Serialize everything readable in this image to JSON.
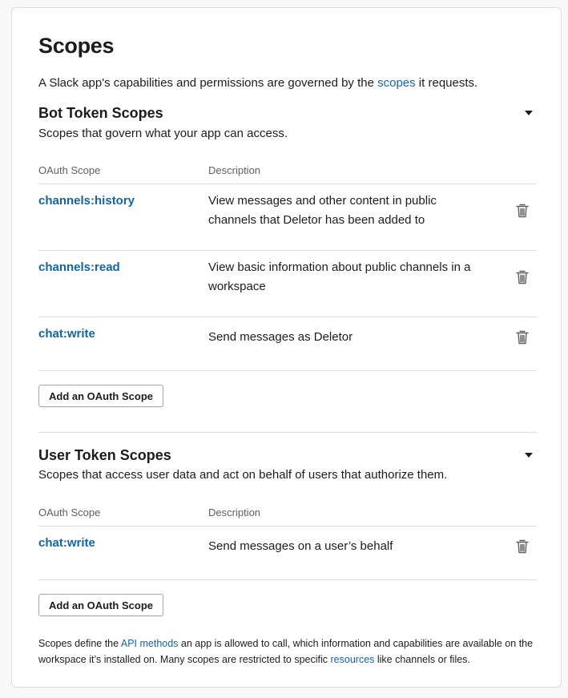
{
  "title": "Scopes",
  "intro": {
    "before": "A Slack app's capabilities and permissions are governed by the ",
    "link": "scopes",
    "after": " it requests."
  },
  "bot": {
    "title": "Bot Token Scopes",
    "subtitle": "Scopes that govern what your app can access.",
    "col_scope": "OAuth Scope",
    "col_desc": "Description",
    "rows": [
      {
        "name": "channels:history",
        "desc": "View messages and other content in public channels that Deletor has been added to"
      },
      {
        "name": "channels:read",
        "desc": "View basic information about public channels in a workspace"
      },
      {
        "name": "chat:write",
        "desc": "Send messages as Deletor"
      }
    ],
    "add_label": "Add an OAuth Scope"
  },
  "user": {
    "title": "User Token Scopes",
    "subtitle": "Scopes that access user data and act on behalf of users that authorize them.",
    "col_scope": "OAuth Scope",
    "col_desc": "Description",
    "rows": [
      {
        "name": "chat:write",
        "desc": "Send messages on a user’s behalf"
      }
    ],
    "add_label": "Add an OAuth Scope"
  },
  "footer": {
    "t1": "Scopes define the ",
    "link1": "API methods",
    "t2": " an app is allowed to call, which information and capabilities are available on the workspace it’s installed on. Many scopes are restricted to specific ",
    "link2": "resources",
    "t3": " like channels or files."
  },
  "colors": {
    "link": "#1264a3",
    "border": "#dddddd",
    "text": "#1d1c1d"
  }
}
